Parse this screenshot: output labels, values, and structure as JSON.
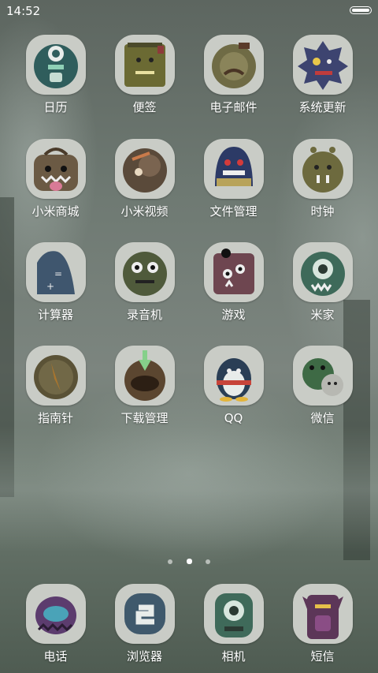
{
  "status_bar": {
    "time": "14:52"
  },
  "pager": {
    "pages": 3,
    "current": 2
  },
  "apps": [
    {
      "label": "日历",
      "icon": "calendar-monster-icon"
    },
    {
      "label": "便签",
      "icon": "notes-monster-icon"
    },
    {
      "label": "电子邮件",
      "icon": "email-monster-icon"
    },
    {
      "label": "系统更新",
      "icon": "system-update-monster-icon"
    },
    {
      "label": "小米商城",
      "icon": "mi-store-monster-icon"
    },
    {
      "label": "小米视频",
      "icon": "mi-video-monster-icon"
    },
    {
      "label": "文件管理",
      "icon": "file-manager-monster-icon"
    },
    {
      "label": "时钟",
      "icon": "clock-monster-icon"
    },
    {
      "label": "计算器",
      "icon": "calculator-monster-icon"
    },
    {
      "label": "录音机",
      "icon": "recorder-monster-icon"
    },
    {
      "label": "游戏",
      "icon": "games-monster-icon"
    },
    {
      "label": "米家",
      "icon": "mijia-monster-icon"
    },
    {
      "label": "指南针",
      "icon": "compass-monster-icon"
    },
    {
      "label": "下载管理",
      "icon": "downloads-monster-icon"
    },
    {
      "label": "QQ",
      "icon": "qq-penguin-icon"
    },
    {
      "label": "微信",
      "icon": "wechat-monster-icon"
    }
  ],
  "dock": [
    {
      "label": "电话",
      "icon": "phone-monster-icon"
    },
    {
      "label": "浏览器",
      "icon": "browser-monster-icon"
    },
    {
      "label": "相机",
      "icon": "camera-monster-icon"
    },
    {
      "label": "短信",
      "icon": "messages-monster-icon"
    }
  ]
}
